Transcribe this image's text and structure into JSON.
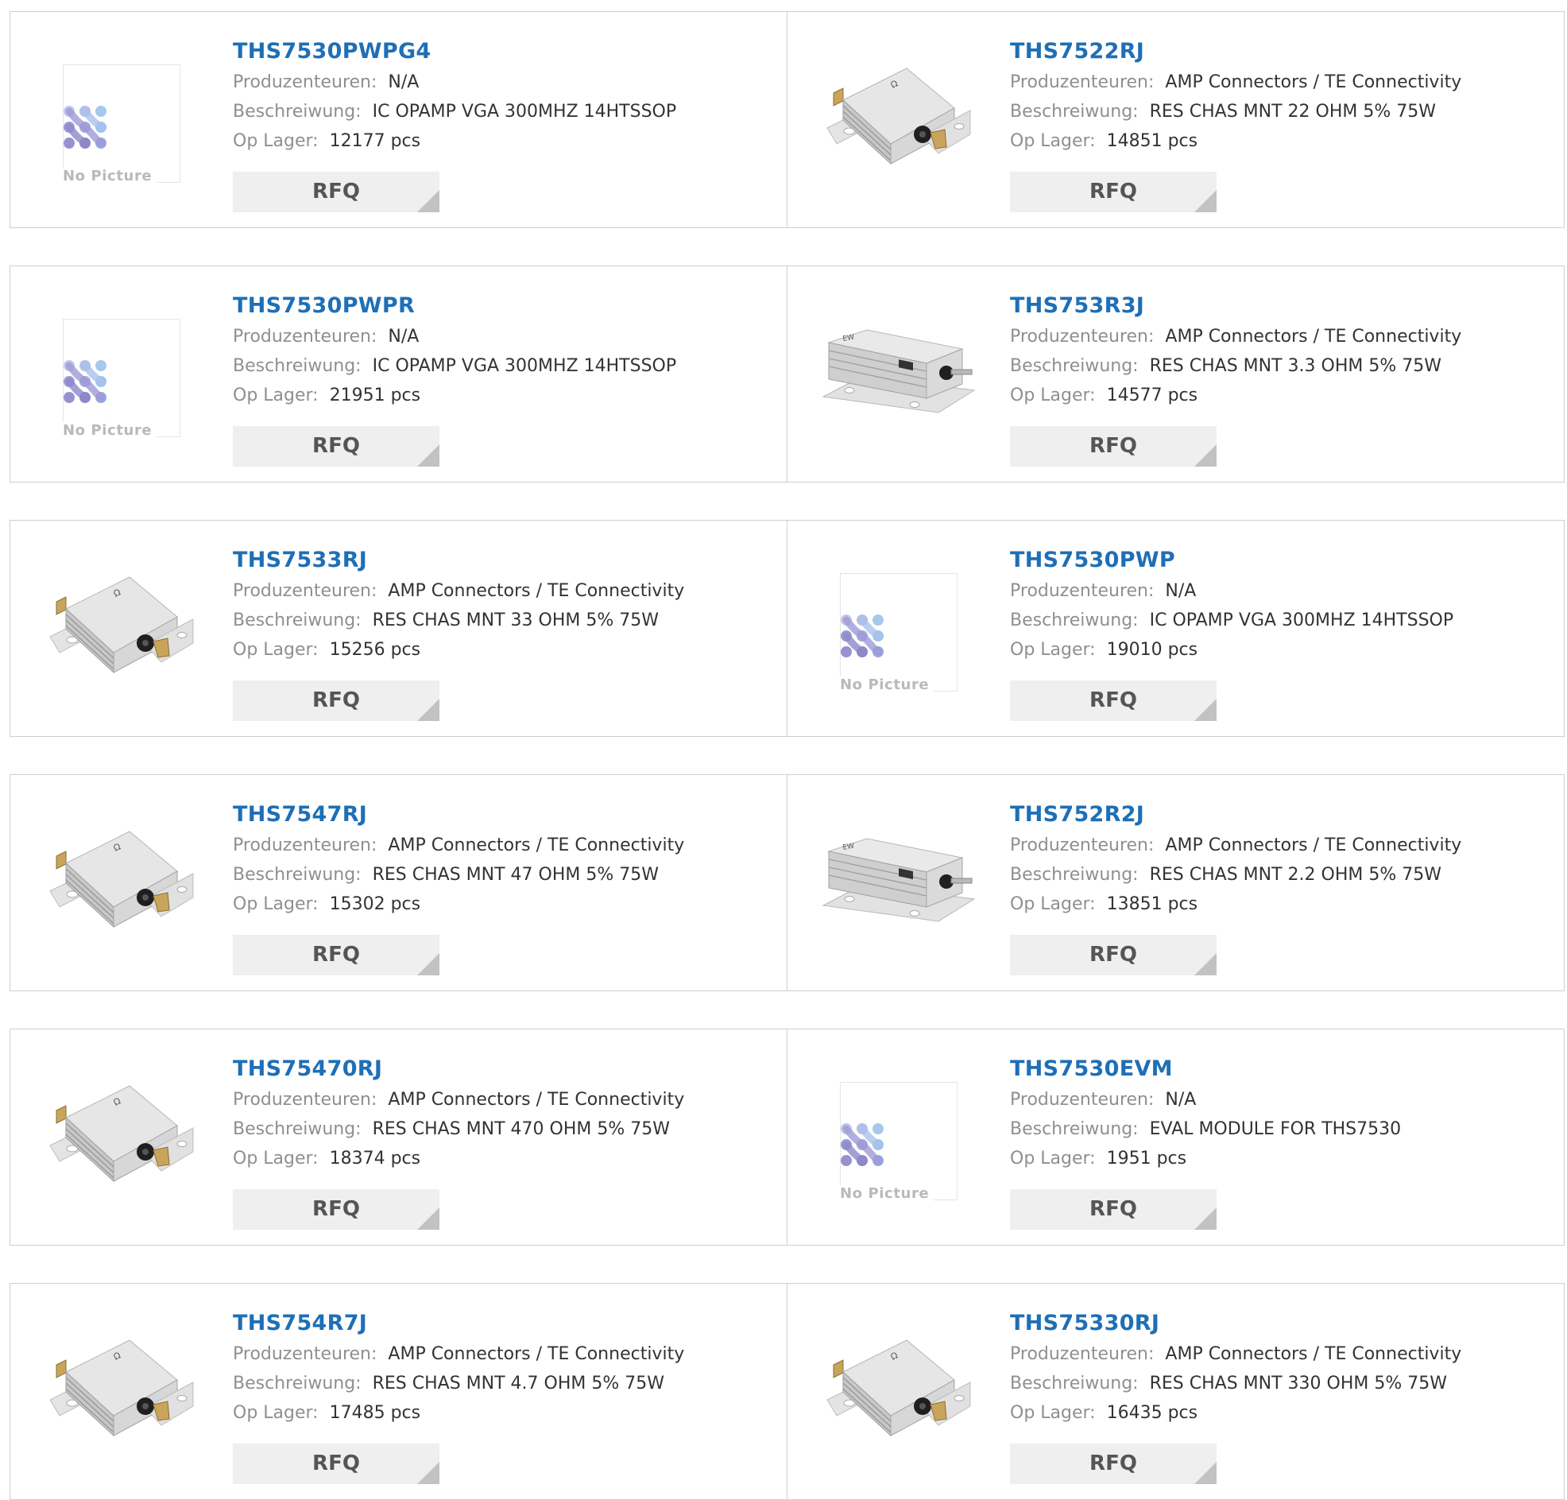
{
  "labels": {
    "manufacturer": "Produzenteuren:",
    "description": "Beschreiwung:",
    "stock": "Op Lager:",
    "rfq": "RFQ",
    "no_picture": "No Picture"
  },
  "products": [
    {
      "part": "THS7530PWPG4",
      "manufacturer": "N/A",
      "description": "IC OPAMP VGA 300MHZ 14HTSSOP",
      "stock": "12177 pcs",
      "image": "no-picture"
    },
    {
      "part": "THS7522RJ",
      "manufacturer": "AMP Connectors / TE Connectivity",
      "description": "RES CHAS MNT 22 OHM 5% 75W",
      "stock": "14851 pcs",
      "image": "resistor-angled"
    },
    {
      "part": "THS7530PWPR",
      "manufacturer": "N/A",
      "description": "IC OPAMP VGA 300MHZ 14HTSSOP",
      "stock": "21951 pcs",
      "image": "no-picture"
    },
    {
      "part": "THS753R3J",
      "manufacturer": "AMP Connectors / TE Connectivity",
      "description": "RES CHAS MNT 3.3 OHM 5% 75W",
      "stock": "14577 pcs",
      "image": "resistor-side"
    },
    {
      "part": "THS7533RJ",
      "manufacturer": "AMP Connectors / TE Connectivity",
      "description": "RES CHAS MNT 33 OHM 5% 75W",
      "stock": "15256 pcs",
      "image": "resistor-angled"
    },
    {
      "part": "THS7530PWP",
      "manufacturer": "N/A",
      "description": "IC OPAMP VGA 300MHZ 14HTSSOP",
      "stock": "19010 pcs",
      "image": "no-picture"
    },
    {
      "part": "THS7547RJ",
      "manufacturer": "AMP Connectors / TE Connectivity",
      "description": "RES CHAS MNT 47 OHM 5% 75W",
      "stock": "15302 pcs",
      "image": "resistor-angled"
    },
    {
      "part": "THS752R2J",
      "manufacturer": "AMP Connectors / TE Connectivity",
      "description": "RES CHAS MNT 2.2 OHM 5% 75W",
      "stock": "13851 pcs",
      "image": "resistor-side"
    },
    {
      "part": "THS75470RJ",
      "manufacturer": "AMP Connectors / TE Connectivity",
      "description": "RES CHAS MNT 470 OHM 5% 75W",
      "stock": "18374 pcs",
      "image": "resistor-angled"
    },
    {
      "part": "THS7530EVM",
      "manufacturer": "N/A",
      "description": "EVAL MODULE FOR THS7530",
      "stock": "1951 pcs",
      "image": "no-picture"
    },
    {
      "part": "THS754R7J",
      "manufacturer": "AMP Connectors / TE Connectivity",
      "description": "RES CHAS MNT 4.7 OHM 5% 75W",
      "stock": "17485 pcs",
      "image": "resistor-angled"
    },
    {
      "part": "THS75330RJ",
      "manufacturer": "AMP Connectors / TE Connectivity",
      "description": "RES CHAS MNT 330 OHM 5% 75W",
      "stock": "16435 pcs",
      "image": "resistor-angled"
    }
  ],
  "colors": {
    "title": "#1e6fb6",
    "label": "#8f8f8f",
    "value": "#333333",
    "button_bg": "#efefef",
    "border": "#cfcfcf"
  }
}
